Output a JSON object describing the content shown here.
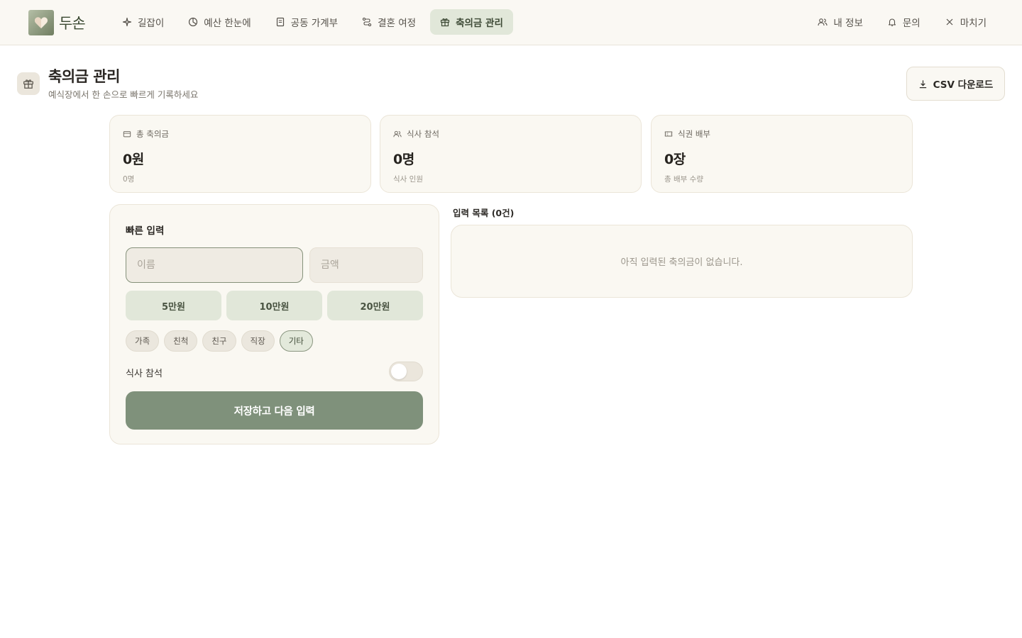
{
  "header": {
    "logo_text": "두손",
    "nav": [
      {
        "label": "길잡이",
        "icon": "sparkle-icon"
      },
      {
        "label": "예산 한눈에",
        "icon": "pie-chart-icon"
      },
      {
        "label": "공동 가계부",
        "icon": "ledger-icon"
      },
      {
        "label": "결혼 여정",
        "icon": "route-icon"
      },
      {
        "label": "축의금 관리",
        "icon": "gift-icon",
        "active": true
      }
    ],
    "util": [
      {
        "label": "내 정보",
        "icon": "users-icon"
      },
      {
        "label": "문의",
        "icon": "bell-icon"
      },
      {
        "label": "마치기",
        "icon": "close-icon"
      }
    ]
  },
  "page": {
    "title": "축의금 관리",
    "subtitle": "예식장에서 한 손으로 빠르게 기록하세요",
    "csv_label": "CSV 다운로드"
  },
  "stats": [
    {
      "label": "총 축의금",
      "value": "0원",
      "sub": "0명",
      "icon": "wallet-icon"
    },
    {
      "label": "식사 참석",
      "value": "0명",
      "sub": "식사 인원",
      "icon": "users-icon"
    },
    {
      "label": "식권 배부",
      "value": "0장",
      "sub": "총 배부 수량",
      "icon": "ticket-icon"
    }
  ],
  "form": {
    "title": "빠른 입력",
    "name_placeholder": "이름",
    "amount_placeholder": "금액",
    "amount_buttons": [
      "5만원",
      "10만원",
      "20만원"
    ],
    "categories": [
      "가족",
      "친척",
      "친구",
      "직장",
      "기타"
    ],
    "selected_category": "기타",
    "meal_label": "식사 참석",
    "meal_on": false,
    "save_label": "저장하고 다음 입력"
  },
  "list": {
    "title": "입력 목록 (0건)",
    "empty": "아직 입력된 축의금이 없습니다."
  },
  "colors": {
    "accent": "#7f917b",
    "accent_soft": "#e1e7d9",
    "background": "#faf8f2"
  }
}
